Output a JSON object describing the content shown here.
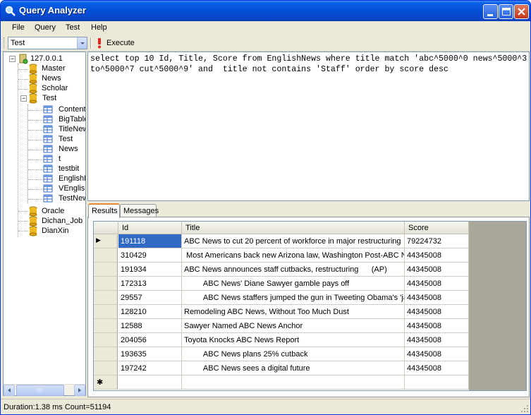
{
  "window": {
    "title": "Query Analyzer"
  },
  "menu": [
    "File",
    "Query",
    "Test",
    "Help"
  ],
  "toolbar": {
    "database": "Test",
    "execute_label": "Execute"
  },
  "tree": {
    "root": "127.0.0.1",
    "databases": [
      "Master",
      "News",
      "Scholar",
      "Test"
    ],
    "tables": [
      "ContentN",
      "BigTable",
      "TitleNews",
      "Test",
      "News",
      "t",
      "testbit",
      "EnglishNe",
      "VEnglishN",
      "TestNew"
    ],
    "more_databases": [
      "Oracle",
      "Dichan_Job",
      "DianXin"
    ]
  },
  "query": "select top 10 Id, Title, Score from EnglishNews where title match 'abc^5000^0 news^5000^3 to^5000^7 cut^5000^9' and  title not contains 'Staff' order by score desc",
  "tabs": [
    "Results",
    "Messages"
  ],
  "grid": {
    "columns": [
      "Id",
      "Title",
      "Score"
    ],
    "rows": [
      [
        "191118",
        "ABC News to cut 20 percent of workforce in major restructuring",
        "79224732"
      ],
      [
        "310429",
        " Most Americans back new Arizona law, Washington Post-ABC News ...",
        "44345008"
      ],
      [
        "191934",
        "ABC News announces staff cutbacks, restructuring      (AP)",
        "44345008"
      ],
      [
        "172313",
        "         ABC News' Diane Sawyer gamble pays off",
        "44345008"
      ],
      [
        "29557",
        "         ABC News staffers jumped the gun in Tweeting Obama's 'jackass...",
        "44345008"
      ],
      [
        "128210",
        "Remodeling ABC News, Without Too Much Dust",
        "44345008"
      ],
      [
        "12588",
        "Sawyer Named ABC News Anchor",
        "44345008"
      ],
      [
        "204056",
        "Toyota Knocks ABC News Report",
        "44345008"
      ],
      [
        "193635",
        "         ABC News plans 25% cutback",
        "44345008"
      ],
      [
        "197242",
        "         ABC News sees a digital future",
        "44345008"
      ]
    ],
    "current_row_marker": "▶",
    "new_row_marker": "✱"
  },
  "status": "Duration:1.38 ms Count=51194"
}
